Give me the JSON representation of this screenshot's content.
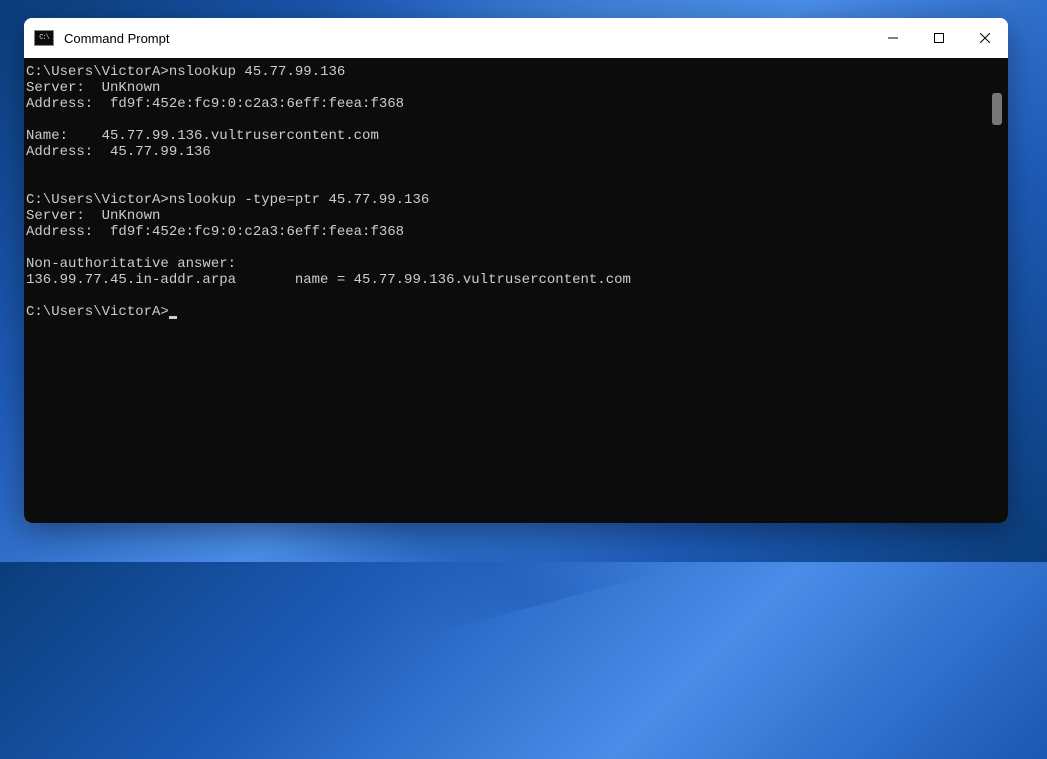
{
  "window": {
    "title": "Command Prompt",
    "icon_label": "C:\\"
  },
  "terminal": {
    "lines": [
      "C:\\Users\\VictorA>nslookup 45.77.99.136",
      "Server:  UnKnown",
      "Address:  fd9f:452e:fc9:0:c2a3:6eff:feea:f368",
      "",
      "Name:    45.77.99.136.vultrusercontent.com",
      "Address:  45.77.99.136",
      "",
      "",
      "C:\\Users\\VictorA>nslookup -type=ptr 45.77.99.136",
      "Server:  UnKnown",
      "Address:  fd9f:452e:fc9:0:c2a3:6eff:feea:f368",
      "",
      "Non-authoritative answer:",
      "136.99.77.45.in-addr.arpa       name = 45.77.99.136.vultrusercontent.com",
      "",
      "C:\\Users\\VictorA>"
    ],
    "current_prompt": "C:\\Users\\VictorA>"
  }
}
